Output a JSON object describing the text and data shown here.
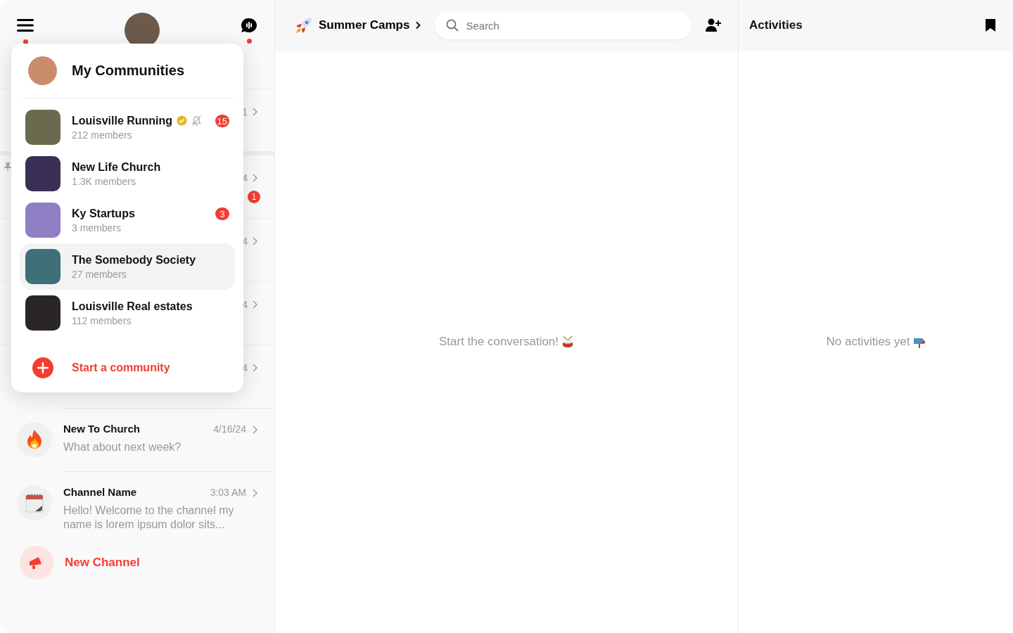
{
  "sidebar": {
    "menu_notification": true,
    "chat_notification": true,
    "hidden_channels": [
      {
        "time": "1"
      },
      {
        "time": "4",
        "pinned": true,
        "unread": "1"
      },
      {
        "time": "4"
      },
      {
        "time": "4"
      },
      {
        "time": "4"
      }
    ],
    "channels": [
      {
        "kind": "fire",
        "name": "New To Church",
        "time": "4/16/24",
        "message": "What about next week?"
      },
      {
        "kind": "calendar",
        "name": "Channel Name",
        "time": "3:03 AM",
        "message": "Hello! Welcome to the channel my name is lorem ipsum dolor sits..."
      }
    ],
    "new_channel": "New Channel"
  },
  "communities_menu": {
    "title": "My Communities",
    "items": [
      {
        "name": "Louisville Running",
        "members": "212 members",
        "verified": true,
        "muted": true,
        "unread": "15",
        "selected": false
      },
      {
        "name": "New Life Church",
        "members": "1.3K members",
        "selected": false
      },
      {
        "name": "Ky Startups",
        "members": "3 members",
        "unread": "3",
        "selected": false
      },
      {
        "name": "The Somebody Society",
        "members": "27 members",
        "selected": true
      },
      {
        "name": "Louisville Real estates",
        "members": "112 members",
        "selected": false
      }
    ],
    "start_action": "Start a community"
  },
  "conversation": {
    "title": "Summer Camps",
    "search": {
      "placeholder": "Search"
    },
    "empty_text": "Start the conversation!"
  },
  "activities": {
    "title": "Activities",
    "empty_text": "No activities yet"
  }
}
